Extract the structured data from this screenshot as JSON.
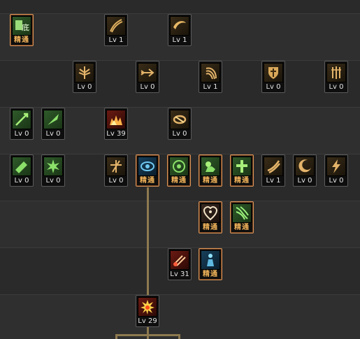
{
  "skill_tree": {
    "rows": [
      [
        {
          "label": "精通",
          "icon": "green-scroll-icon",
          "palette": "g",
          "mastered": true
        },
        {
          "label": "Lv 1",
          "icon": "golden-slash-icon",
          "palette": "y",
          "mastered": false
        },
        {
          "label": "Lv 1",
          "icon": "golden-wing-icon",
          "palette": "y",
          "mastered": false
        }
      ],
      [
        {
          "label": "Lv 0",
          "icon": "golden-winged-sword-icon",
          "palette": "y",
          "mastered": false
        },
        {
          "label": "Lv 0",
          "icon": "golden-arrow-icon",
          "palette": "y",
          "mastered": false
        },
        {
          "label": "Lv 1",
          "icon": "golden-spiral-icon",
          "palette": "y",
          "mastered": false
        },
        {
          "label": "Lv 0",
          "icon": "golden-shield-icon",
          "palette": "y",
          "mastered": false
        },
        {
          "label": "Lv 0",
          "icon": "golden-triple-blade-icon",
          "palette": "y",
          "mastered": false
        }
      ],
      [
        {
          "label": "Lv 0",
          "icon": "green-sword-icon",
          "palette": "g",
          "mastered": false
        },
        {
          "label": "Lv 0",
          "icon": "green-blade-icon",
          "palette": "g",
          "mastered": false
        },
        {
          "label": "Lv 39",
          "icon": "red-flame-icon",
          "palette": "r",
          "mastered": false
        },
        {
          "label": "Lv 0",
          "icon": "golden-ring-icon",
          "palette": "y",
          "mastered": false
        }
      ],
      [
        {
          "label": "Lv 0",
          "icon": "green-plank-icon",
          "palette": "g",
          "mastered": false
        },
        {
          "label": "Lv 0",
          "icon": "green-burst-icon",
          "palette": "g",
          "mastered": false
        },
        {
          "label": "Lv 0",
          "icon": "golden-cross-sword-icon",
          "palette": "y",
          "mastered": false
        },
        {
          "label": "精通",
          "icon": "blue-eye-icon",
          "palette": "b",
          "mastered": true
        },
        {
          "label": "精通",
          "icon": "green-eye-icon",
          "palette": "g",
          "mastered": true
        },
        {
          "label": "精通",
          "icon": "green-fist-icon",
          "palette": "g",
          "mastered": true
        },
        {
          "label": "精通",
          "icon": "green-cross-icon",
          "palette": "g",
          "mastered": true
        },
        {
          "label": "Lv 1",
          "icon": "golden-gust-icon",
          "palette": "y",
          "mastered": false
        },
        {
          "label": "Lv 0",
          "icon": "golden-crescent-icon",
          "palette": "y",
          "mastered": false
        },
        {
          "label": "Lv 0",
          "icon": "golden-lightning-icon",
          "palette": "y",
          "mastered": false
        }
      ],
      [
        {
          "label": "精通",
          "icon": "heart-shield-icon",
          "palette": "y",
          "mastered": true
        },
        {
          "label": "精通",
          "icon": "green-cyclone-icon",
          "palette": "g",
          "mastered": true
        }
      ],
      [
        {
          "label": "Lv 31",
          "icon": "red-impact-icon",
          "palette": "r",
          "mastered": false
        },
        {
          "label": "精通",
          "icon": "blue-figure-icon",
          "palette": "b",
          "mastered": true
        }
      ],
      [
        {
          "label": "Lv 29",
          "icon": "red-explosion-icon",
          "palette": "r",
          "mastered": false
        }
      ]
    ]
  }
}
